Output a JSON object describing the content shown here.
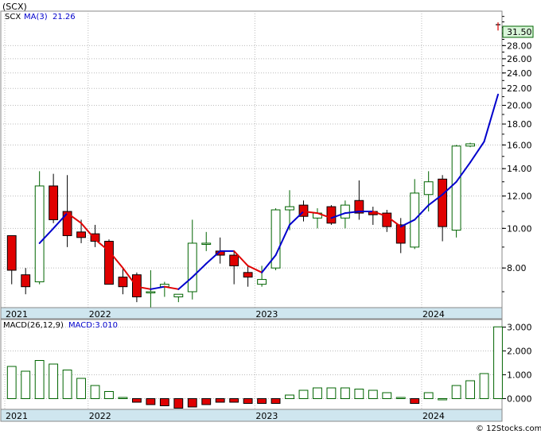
{
  "page_title": "(SCX)",
  "chart_data": [
    {
      "type": "candlestick",
      "ticker_label": "SCX",
      "indicator_label": "MA(3)",
      "indicator_value": "21.26",
      "current_price_label": "31.50",
      "y_scale": "log",
      "ylim": [
        6.4,
        34
      ],
      "y_ticks": [
        "28.00",
        "26.00",
        "24.00",
        "22.00",
        "20.00",
        "18.00",
        "16.00",
        "14.00",
        "12.00",
        "10.00",
        "8.00"
      ],
      "y_tick_values": [
        28,
        26,
        24,
        22,
        20,
        18,
        16,
        14,
        12,
        10,
        8
      ],
      "x_ticks": [
        "2021",
        "2022",
        "2023",
        "2024"
      ],
      "x_tick_index": [
        0,
        6,
        18,
        30
      ],
      "grid": true,
      "colors": {
        "up": "#ffffff",
        "up_border": "#006400",
        "down": "#e00000",
        "ma_rising": "#0000cc",
        "ma_falling": "#e00000",
        "label_blue": "#0000cc",
        "price_box": "#d8f5d8"
      },
      "candles": [
        {
          "o": 9.6,
          "h": 9.6,
          "l": 7.3,
          "c": 7.9
        },
        {
          "o": 7.7,
          "h": 8.0,
          "l": 6.9,
          "c": 7.2
        },
        {
          "o": 7.4,
          "h": 13.8,
          "l": 7.3,
          "c": 12.7
        },
        {
          "o": 12.7,
          "h": 13.6,
          "l": 10.3,
          "c": 10.5
        },
        {
          "o": 11.0,
          "h": 13.5,
          "l": 9.0,
          "c": 9.6
        },
        {
          "o": 9.8,
          "h": 10.5,
          "l": 9.2,
          "c": 9.5
        },
        {
          "o": 9.7,
          "h": 10.2,
          "l": 9.0,
          "c": 9.3
        },
        {
          "o": 9.3,
          "h": 9.4,
          "l": 7.4,
          "c": 7.3
        },
        {
          "o": 7.6,
          "h": 8.0,
          "l": 6.9,
          "c": 7.2
        },
        {
          "o": 7.7,
          "h": 7.8,
          "l": 6.6,
          "c": 6.8
        },
        {
          "o": 7.0,
          "h": 7.9,
          "l": 6.2,
          "c": 7.0
        },
        {
          "o": 7.2,
          "h": 7.4,
          "l": 6.8,
          "c": 7.3
        },
        {
          "o": 6.8,
          "h": 6.9,
          "l": 6.6,
          "c": 6.9
        },
        {
          "o": 7.0,
          "h": 10.5,
          "l": 6.7,
          "c": 9.2
        },
        {
          "o": 9.2,
          "h": 9.8,
          "l": 8.8,
          "c": 9.2
        },
        {
          "o": 8.8,
          "h": 9.5,
          "l": 8.2,
          "c": 8.6
        },
        {
          "o": 8.6,
          "h": 8.8,
          "l": 7.3,
          "c": 8.1
        },
        {
          "o": 7.8,
          "h": 8.1,
          "l": 7.2,
          "c": 7.6
        },
        {
          "o": 7.3,
          "h": 8.1,
          "l": 7.2,
          "c": 7.5
        },
        {
          "o": 8.0,
          "h": 11.2,
          "l": 7.9,
          "c": 11.1
        },
        {
          "o": 11.1,
          "h": 12.4,
          "l": 9.9,
          "c": 11.3
        },
        {
          "o": 11.4,
          "h": 11.7,
          "l": 10.4,
          "c": 10.7
        },
        {
          "o": 10.6,
          "h": 11.2,
          "l": 10.0,
          "c": 10.9
        },
        {
          "o": 11.3,
          "h": 11.4,
          "l": 10.2,
          "c": 10.3
        },
        {
          "o": 10.6,
          "h": 11.7,
          "l": 10.0,
          "c": 11.4
        },
        {
          "o": 11.7,
          "h": 13.1,
          "l": 10.5,
          "c": 10.9
        },
        {
          "o": 11.0,
          "h": 11.3,
          "l": 10.2,
          "c": 10.8
        },
        {
          "o": 10.9,
          "h": 11.1,
          "l": 9.8,
          "c": 10.1
        },
        {
          "o": 10.2,
          "h": 10.6,
          "l": 8.7,
          "c": 9.2
        },
        {
          "o": 9.0,
          "h": 13.2,
          "l": 8.9,
          "c": 12.2
        },
        {
          "o": 12.1,
          "h": 13.8,
          "l": 11.0,
          "c": 13.0
        },
        {
          "o": 13.2,
          "h": 13.5,
          "l": 9.3,
          "c": 10.1
        },
        {
          "o": 9.9,
          "h": 16.0,
          "l": 9.5,
          "c": 15.9
        },
        {
          "o": 15.9,
          "h": 16.2,
          "l": 15.8,
          "c": 16.1
        },
        {
          "o": null,
          "h": null,
          "l": null,
          "c": null
        },
        {
          "o": 31.4,
          "h": 31.9,
          "l": 30.5,
          "c": 31.5
        }
      ],
      "ma3": [
        null,
        null,
        9.2,
        10.0,
        10.9,
        10.3,
        9.4,
        8.8,
        8.0,
        7.2,
        7.1,
        7.2,
        7.1,
        7.6,
        8.2,
        8.8,
        8.8,
        8.1,
        7.8,
        8.6,
        10.2,
        11.0,
        10.9,
        10.6,
        10.9,
        11.0,
        11.0,
        10.7,
        10.1,
        10.5,
        11.4,
        12.1,
        13.0,
        14.5,
        16.3,
        21.26
      ]
    },
    {
      "type": "bar",
      "label": "MACD(26,12,9)",
      "value_label": "MACD:3.010",
      "ylim": [
        -0.45,
        3.25
      ],
      "y_ticks": [
        "3.000",
        "2.000",
        "1.000",
        "0.000"
      ],
      "y_tick_values": [
        3,
        2,
        1,
        0
      ],
      "x_ticks": [
        "2021",
        "2022",
        "2023",
        "2024"
      ],
      "values": [
        1.35,
        1.15,
        1.6,
        1.45,
        1.2,
        0.85,
        0.55,
        0.3,
        0.05,
        -0.15,
        -0.25,
        -0.3,
        -0.4,
        -0.35,
        -0.25,
        -0.15,
        -0.15,
        -0.2,
        -0.2,
        -0.2,
        0.15,
        0.35,
        0.45,
        0.45,
        0.45,
        0.4,
        0.35,
        0.25,
        0.05,
        -0.2,
        0.25,
        0.0,
        0.55,
        0.75,
        1.05,
        3.01
      ],
      "colors": {
        "up": "#006400",
        "down": "#e00000"
      }
    }
  ],
  "footer": {
    "copyright": "© 12Stocks.com"
  }
}
